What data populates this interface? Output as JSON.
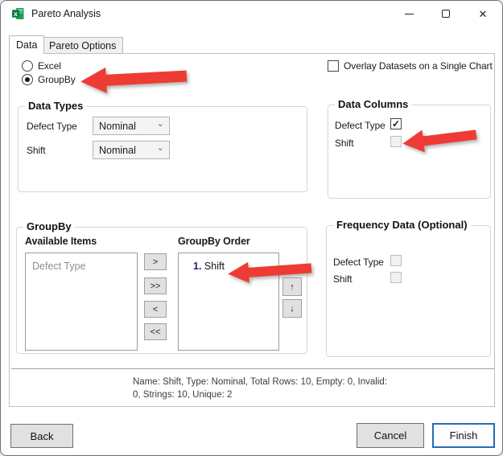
{
  "window": {
    "title": "Pareto Analysis"
  },
  "glyphs": {
    "excel_x": "x",
    "close": "✕",
    "check": "✓",
    "chevron": "⌄",
    "up": "↑",
    "down": "↓"
  },
  "tabs": [
    {
      "label": "Data",
      "active": true
    },
    {
      "label": "Pareto Options",
      "active": false
    }
  ],
  "source_radios": [
    {
      "label": "Excel",
      "selected": false
    },
    {
      "label": "GroupBy",
      "selected": true
    }
  ],
  "overlay_checkbox": {
    "label": "Overlay Datasets on a Single Chart",
    "checked": false
  },
  "data_types": {
    "title": "Data Types",
    "rows": [
      {
        "label": "Defect Type",
        "value": "Nominal"
      },
      {
        "label": "Shift",
        "value": "Nominal"
      }
    ]
  },
  "data_columns": {
    "title": "Data Columns",
    "rows": [
      {
        "label": "Defect Type",
        "checked": true
      },
      {
        "label": "Shift",
        "checked": false
      }
    ]
  },
  "groupby": {
    "title": "GroupBy",
    "available_label": "Available Items",
    "available_items": [
      "Defect Type"
    ],
    "order_label": "GroupBy Order",
    "order_items": [
      {
        "index": "1.",
        "label": "Shift"
      }
    ],
    "transfer_buttons": [
      ">",
      ">>",
      "<",
      "<<"
    ]
  },
  "frequency": {
    "title": "Frequency Data (Optional)",
    "rows": [
      {
        "label": "Defect Type",
        "checked": false
      },
      {
        "label": "Shift",
        "checked": false
      }
    ]
  },
  "status": {
    "line1": "Name: Shift, Type: Nominal, Total Rows: 10, Empty: 0, Invalid:",
    "line2": "0, Strings: 10, Unique: 2"
  },
  "footer_buttons": {
    "back": "Back",
    "cancel": "Cancel",
    "finish": "Finish"
  },
  "colors": {
    "arrow_red": "#ee3b33",
    "finish_border_blue": "#266db6",
    "order_index_navy": "#18227c"
  }
}
